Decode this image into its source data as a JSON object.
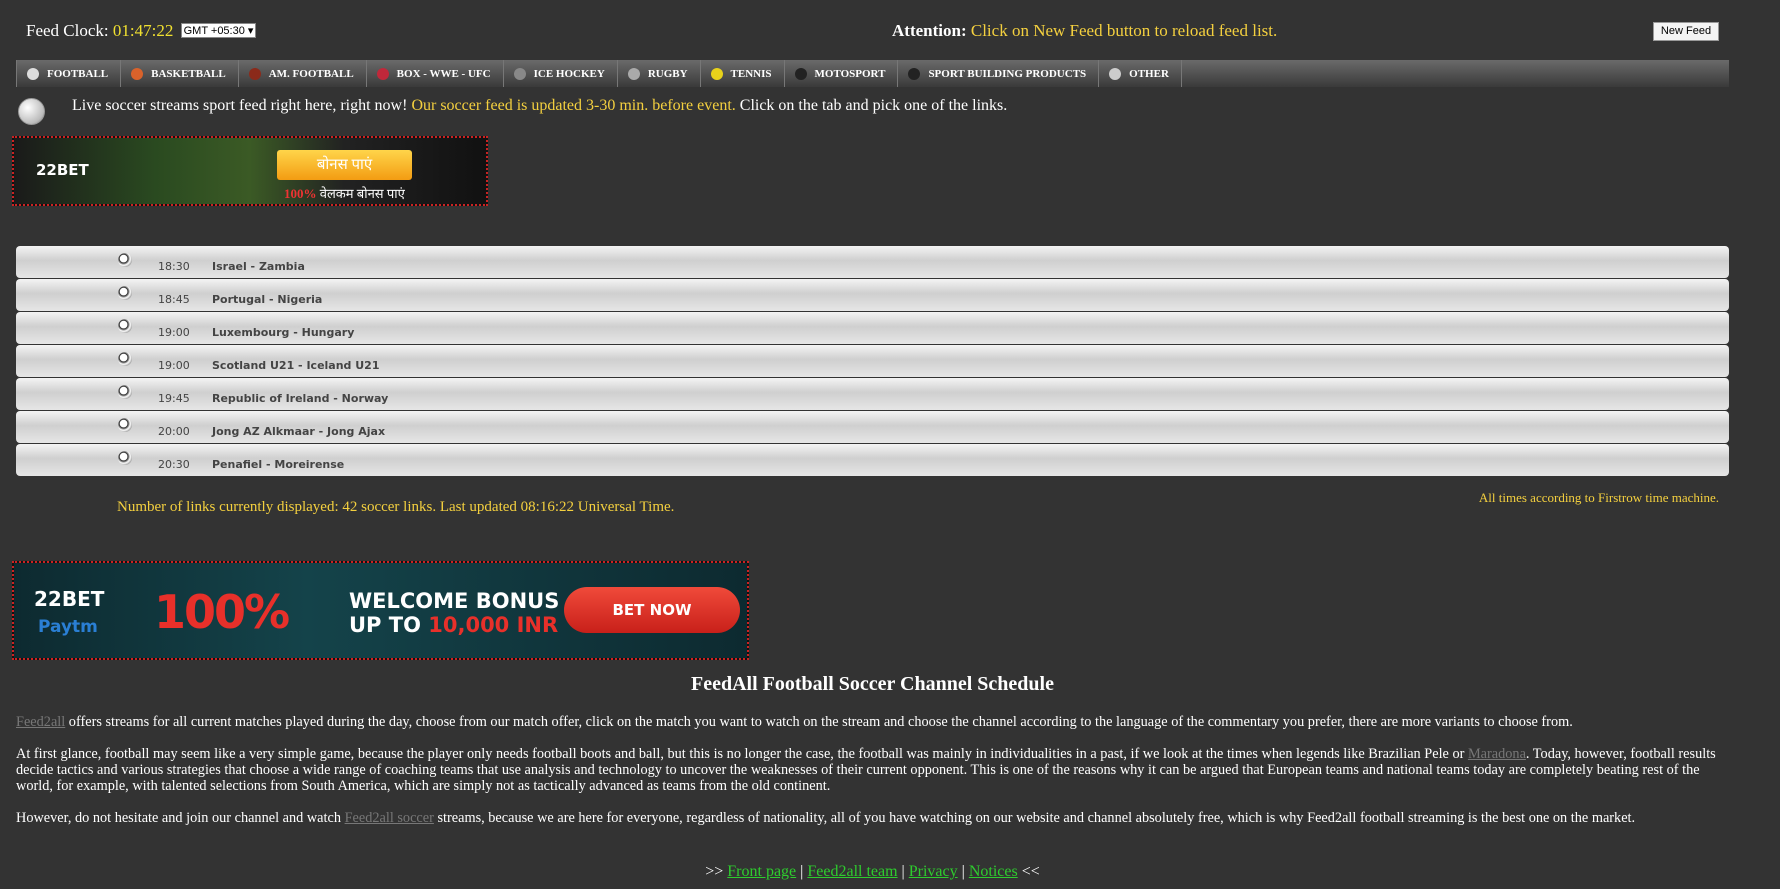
{
  "header": {
    "clock_label": "Feed Clock:",
    "clock_time": "01:47:22",
    "timezone": "GMT +05:30 ▾",
    "attention_label": "Attention:",
    "attention_text": "Click on New Feed button to reload feed list.",
    "new_feed_label": "New Feed"
  },
  "tabs": [
    {
      "label": "FOOTBALL",
      "icon": "soccer-ball-icon",
      "color": "#dddddd"
    },
    {
      "label": "BASKETBALL",
      "icon": "basketball-icon",
      "color": "#d9622b"
    },
    {
      "label": "AM. FOOTBALL",
      "icon": "american-football-icon",
      "color": "#8b2a1a"
    },
    {
      "label": "BOX - WWE - UFC",
      "icon": "boxing-glove-icon",
      "color": "#c0283a"
    },
    {
      "label": "ICE HOCKEY",
      "icon": "hockey-puck-icon",
      "color": "#888888"
    },
    {
      "label": "RUGBY",
      "icon": "rugby-ball-icon",
      "color": "#aaaaaa"
    },
    {
      "label": "TENNIS",
      "icon": "tennis-ball-icon",
      "color": "#e8d21a"
    },
    {
      "label": "MOTOSPORT",
      "icon": "tire-icon",
      "color": "#222222"
    },
    {
      "label": "SPORT BUILDING PRODUCTS",
      "icon": "tire-icon",
      "color": "#222222"
    },
    {
      "label": "OTHER",
      "icon": "arrow-circle-icon",
      "color": "#cccccc"
    }
  ],
  "intro": {
    "text1": "Live soccer streams sport feed right here, right now!",
    "highlight": "Our soccer feed is updated 3-30 min. before event.",
    "text2": "Click on the tab and pick one of the links."
  },
  "banner1": {
    "brand": "22BET",
    "button": "बोनस पाएं",
    "tagline_pct": "100%",
    "tagline": "वेलकम बोनस पाएं"
  },
  "matches": [
    {
      "time": "18:30",
      "match": "Israel - Zambia"
    },
    {
      "time": "18:45",
      "match": "Portugal - Nigeria"
    },
    {
      "time": "19:00",
      "match": "Luxembourg - Hungary"
    },
    {
      "time": "19:00",
      "match": "Scotland U21 - Iceland U21"
    },
    {
      "time": "19:45",
      "match": "Republic of Ireland - Norway"
    },
    {
      "time": "20:00",
      "match": "Jong AZ Alkmaar - Jong Ajax"
    },
    {
      "time": "20:30",
      "match": "Penafiel - Moreirense"
    }
  ],
  "status": {
    "count_text": "Number of links currently displayed: 42 soccer links. Last updated 08:16:22 Universal Time.",
    "all_times": "All times according to Firstrow time machine."
  },
  "banner2": {
    "brand": "22BET",
    "partner": "Paytm",
    "pct": "100%",
    "line1": "WELCOME BONUS",
    "line2a": "UP TO ",
    "line2b": "10,000 INR",
    "button": "BET NOW"
  },
  "article": {
    "title": "FeedAll Football Soccer Channel Schedule",
    "p1_link": "Feed2all",
    "p1": " offers streams for all current matches played during the day, choose from our match offer, click on the match you want to watch on the stream and choose the channel according to the language of the commentary you prefer, there are more variants to choose from.",
    "p2a": "At first glance, football may seem like a very simple game, because the player only needs football boots and ball, but this is no longer the case, the football was mainly in individualities in a past, if we look at the times when legends like Brazilian Pele or ",
    "p2_link": "Maradona",
    "p2b": ". Today, however, football results decide tactics and various strategies that choose a wide range of coaching teams that use analysis and technology to uncover the weaknesses of their current opponent. This is one of the reasons why it can be argued that European teams and national teams today are completely beating rest of the world, for example, with talented selections from South America, which are simply not as tactically advanced as teams from the old continent.",
    "p3a": "However, do not hesitate and join our channel and watch ",
    "p3_link": "Feed2all soccer",
    "p3b": " streams, because we are here for everyone, regardless of nationality, all of you have watching on our website and channel absolutely free, which is why Feed2all football streaming is the best one on the market."
  },
  "footer": {
    "open": ">> ",
    "links": [
      "Front page",
      "Feed2all team",
      "Privacy",
      "Notices"
    ],
    "sep": " | ",
    "close": " <<"
  }
}
